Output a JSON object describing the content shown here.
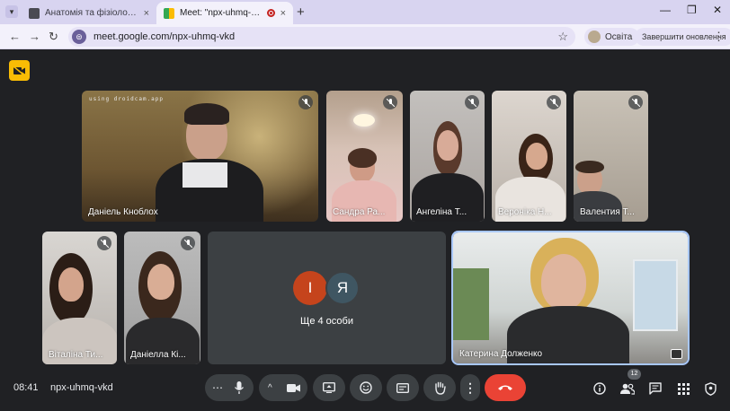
{
  "browser": {
    "tabs": [
      {
        "title": "Анатомія та фізіологія с.г твар",
        "close": "×"
      },
      {
        "title": "Meet: \"npx-uhmq-vkd\"",
        "close": "×"
      }
    ],
    "new_tab": "+",
    "url": "meet.google.com/npx-uhmq-vkd",
    "profile_label": "Освіта",
    "update_label": "Завершити оновлення"
  },
  "meeting": {
    "time": "08:41",
    "code": "npx-uhmq-vkd",
    "participants_count": "12",
    "more_people_label": "Ще 4 особи",
    "more_avatars": [
      {
        "letter": "І",
        "color": "#c5441c"
      },
      {
        "letter": "Я",
        "color": "#3f5662"
      }
    ],
    "watermark": "using droidcam.app",
    "tiles": [
      {
        "name": "Даніель Кноблох"
      },
      {
        "name": "Сандра Ра..."
      },
      {
        "name": "Ангеліна Т..."
      },
      {
        "name": "Вероніка Н..."
      },
      {
        "name": "Валентия Т..."
      },
      {
        "name": "Віталіна Ти..."
      },
      {
        "name": "Даніелла Кі..."
      },
      {
        "name": "Катерина Долженко"
      }
    ]
  }
}
